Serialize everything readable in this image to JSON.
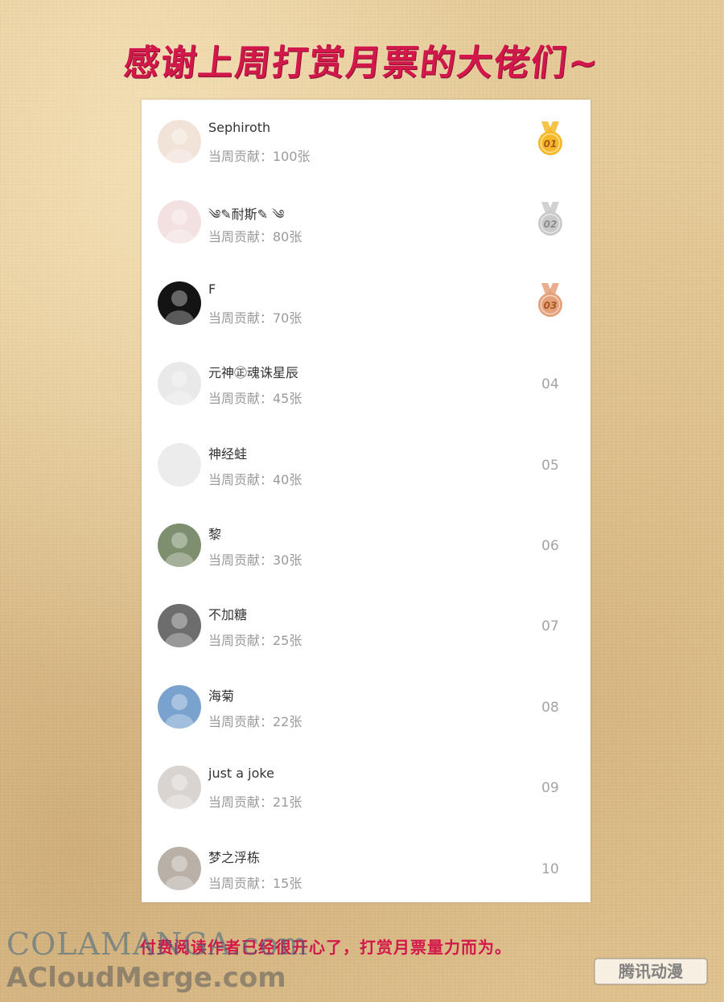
{
  "title": "感谢上周打赏月票的大佬们~",
  "contribution_prefix": "当周贡献：",
  "rows": [
    {
      "name": "Sephiroth",
      "contribution": "当周贡献：100张",
      "rank": "01",
      "medal": "gold",
      "avatar_color": "#f1e3d8"
    },
    {
      "name": "༄✎耐斯✎ ༄",
      "contribution": "当周贡献：80张",
      "rank": "02",
      "medal": "silver",
      "avatar_color": "#f3e1e1"
    },
    {
      "name": "F",
      "contribution": "当周贡献：70张",
      "rank": "03",
      "medal": "bronze",
      "avatar_color": "#141414"
    },
    {
      "name": "元神㊣魂诛星辰",
      "contribution": "当周贡献：45张",
      "rank": "04",
      "avatar_color": "#e9e9e9"
    },
    {
      "name": "神经蛙",
      "contribution": "当周贡献：40张",
      "rank": "05",
      "avatar_color": "#ececec"
    },
    {
      "name": "黎",
      "contribution": "当周贡献：30张",
      "rank": "06",
      "avatar_color": "#7d8f6e"
    },
    {
      "name": "不加糖",
      "contribution": "当周贡献：25张",
      "rank": "07",
      "avatar_color": "#6d6d6d"
    },
    {
      "name": "海菊",
      "contribution": "当周贡献：22张",
      "rank": "08",
      "avatar_color": "#7aa2cf"
    },
    {
      "name": "just a joke",
      "contribution": "当周贡献：21张",
      "rank": "09",
      "avatar_color": "#d9d4d0"
    },
    {
      "name": "梦之浮栋",
      "contribution": "当周贡献：15张",
      "rank": "10",
      "avatar_color": "#b9b1a8"
    }
  ],
  "medal_colors": {
    "gold": "#f5b928",
    "silver": "#c9c9c9",
    "bronze": "#e5a07a"
  },
  "footer": "付费阅读作者已经很开心了，打赏月票量力而为。",
  "watermark": {
    "line1": "COLAMANGA.com",
    "line2": "ACloudMerge.com",
    "logo": "腾讯动漫"
  }
}
